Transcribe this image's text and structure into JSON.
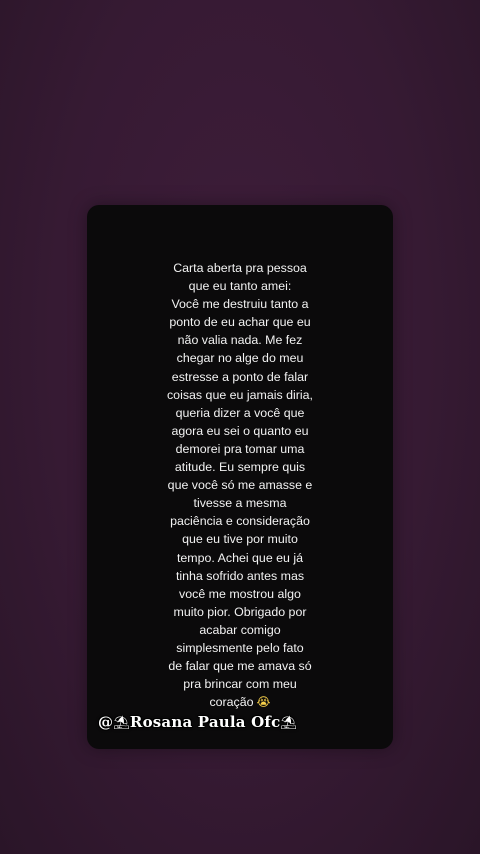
{
  "letter": {
    "lines": [
      "Carta aberta pra pessoa",
      "que eu tanto amei:",
      "Você me destruiu tanto a",
      "ponto de eu achar que eu",
      "não valia nada. Me fez",
      "chegar no alge do meu",
      "estresse a ponto de falar",
      "coisas que eu jamais diria,",
      "queria dizer a você que",
      "agora eu sei o quanto eu",
      "demorei pra tomar uma",
      "atitude. Eu sempre quis",
      "que você só me amasse e",
      "tivesse a mesma",
      "paciência e consideração",
      "que eu tive por muito",
      "tempo. Achei que eu já",
      "tinha sofrido antes mas",
      "você me mostrou algo",
      "muito pior. Obrigado por",
      "acabar comigo",
      "simplesmente pelo fato",
      "de falar que me amava só",
      "pra brincar com meu",
      "coração"
    ],
    "last_line_emoji": "😭"
  },
  "watermark": {
    "prefix": "@",
    "deco": "⛱",
    "name": "Rosana Paula Ofc"
  },
  "colors": {
    "background": "#3a1b36",
    "card": "#0b0a0b",
    "text": "#f2f2f2"
  }
}
